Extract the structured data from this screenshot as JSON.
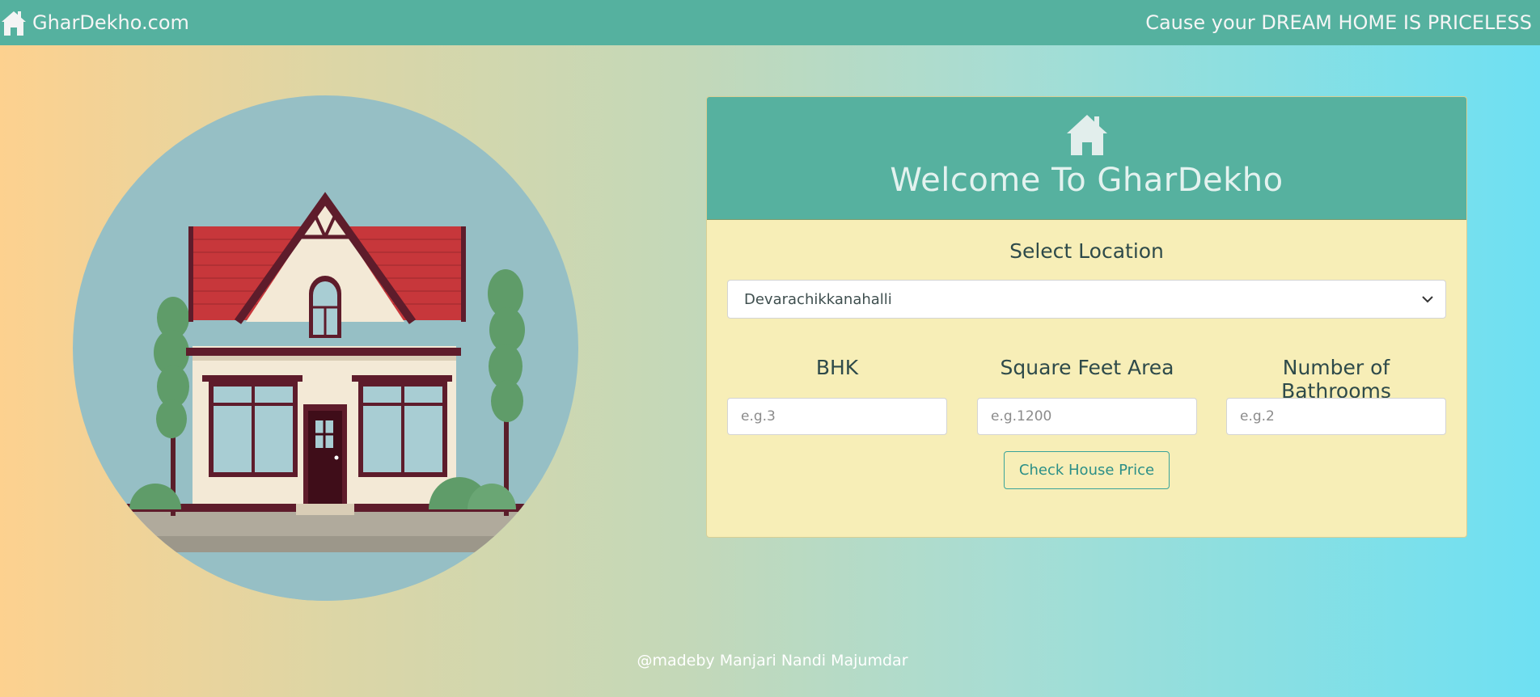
{
  "navbar": {
    "brand": "GharDekho.com",
    "tagline": "Cause your DREAM HOME IS PRICELESS",
    "brand_icon": "home-icon"
  },
  "illustration": {
    "icon": "house-illustration"
  },
  "card": {
    "header_icon": "home-icon",
    "title": "Welcome To GharDekho",
    "location_label": "Select Location",
    "location_value": "Devarachikkanahalli",
    "bhk_label": "BHK",
    "bhk_placeholder": "e.g.3",
    "sqft_label": "Square Feet Area",
    "sqft_placeholder": "e.g.1200",
    "bath_label": "Number of Bathrooms",
    "bath_placeholder": "e.g.2",
    "submit_label": "Check House Price"
  },
  "footer": {
    "credit": "@madeby Manjari Nandi Majumdar"
  },
  "colors": {
    "navbar": "#55b19f",
    "card_header": "#56b19f",
    "card_body": "#f7eeb7",
    "button_border": "#3aa39a"
  }
}
